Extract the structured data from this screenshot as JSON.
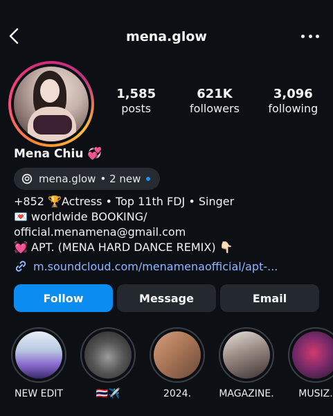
{
  "header": {
    "username": "mena.glow"
  },
  "profile": {
    "display_name": "Mena Chiu 💞",
    "stats": [
      {
        "value": "1,585",
        "label": "posts"
      },
      {
        "value": "621K",
        "label": "followers"
      },
      {
        "value": "3,096",
        "label": "following"
      }
    ],
    "threads": {
      "handle": "mena.glow",
      "badge": "• 2 new"
    },
    "bio": [
      "+852 🏆Actress • Top 11th FDJ • Singer",
      "💌 worldwide BOOKING/",
      "official.menamena@gmail.com",
      "💓 APT. (MENA HARD DANCE REMIX) 👇🏻"
    ],
    "link": "m.soundcloud.com/menamenaofficial/apt-..."
  },
  "actions": {
    "follow": "Follow",
    "message": "Message",
    "email": "Email"
  },
  "highlights": [
    {
      "label": "NEW EDIT"
    },
    {
      "label": "🇹🇭✈️"
    },
    {
      "label": "2024."
    },
    {
      "label": "MAGAZINE."
    },
    {
      "label": "MUSIZ."
    }
  ],
  "colors": {
    "background": "#0c0f14",
    "follow_button": "#0a8cf0",
    "link": "#8fb6ff",
    "new_dot": "#1e90ff"
  },
  "icons": [
    "back-arrow-icon",
    "more-options-icon",
    "threads-icon",
    "link-icon"
  ]
}
